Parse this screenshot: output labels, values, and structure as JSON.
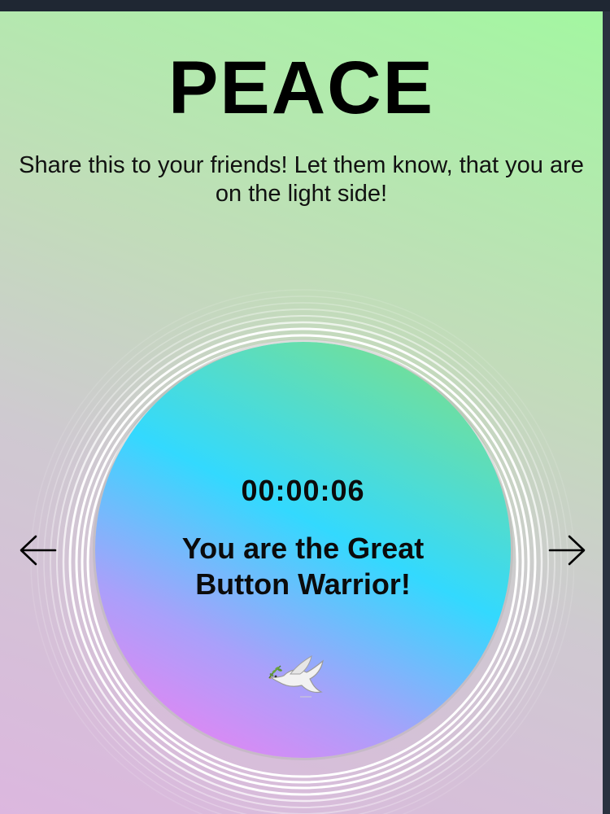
{
  "app": {
    "title": "PEACE",
    "subtitle": "Share this to your friends! Let them know, that you are on the light side!"
  },
  "button": {
    "timer": "00:00:06",
    "rank": "You are the Great Button Warrior!",
    "emblem": "dove-icon"
  },
  "navigation": {
    "prev_icon": "arrow-left-icon",
    "next_icon": "arrow-right-icon"
  },
  "colors": {
    "background_top": "#a3f7a1",
    "background_bottom": "#dcb7df",
    "button_gradient": [
      "#fd7af0",
      "#a9a0fa",
      "#33d9fe",
      "#85e17b"
    ],
    "text": "#000000"
  }
}
